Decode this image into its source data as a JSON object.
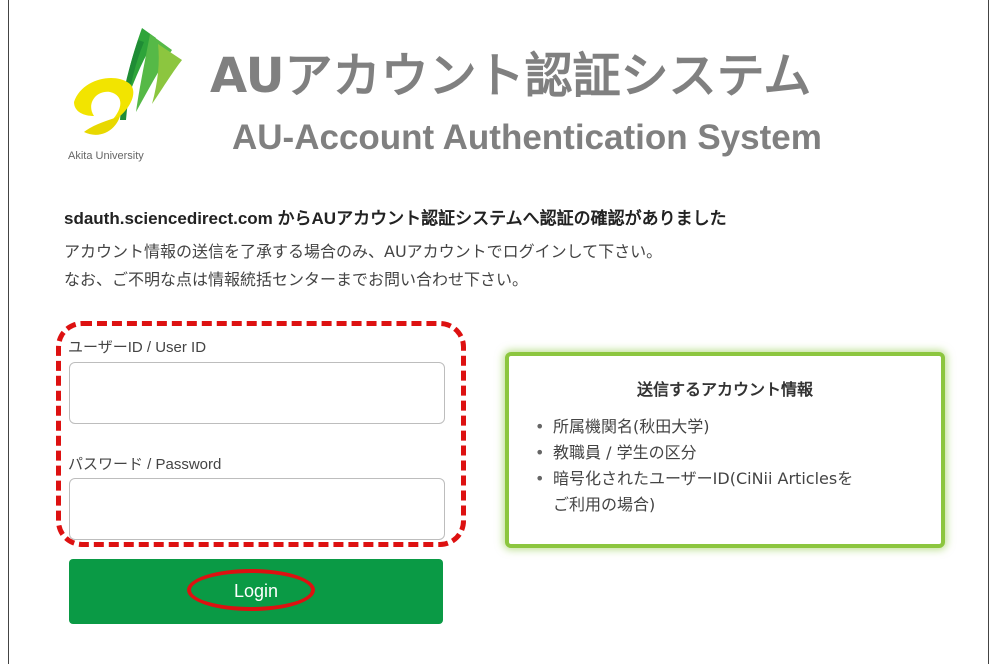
{
  "logo": {
    "caption": "Akita University"
  },
  "header": {
    "title_ja": "AUアカウント認証システム",
    "title_en": "AU-Account Authentication System"
  },
  "notice": "sdauth.sciencedirect.com からAUアカウント認証システムへ認証の確認がありました",
  "description": {
    "line1": "アカウント情報の送信を了承する場合のみ、AUアカウントでログインして下さい。",
    "line2": "なお、ご不明な点は情報統括センターまでお問い合わせ下さい。"
  },
  "form": {
    "userid_label": "ユーザーID / User ID",
    "userid_value": "",
    "password_label": "パスワード / Password",
    "password_value": "",
    "login_label": "Login"
  },
  "info": {
    "title": "送信するアカウント情報",
    "items": [
      "所属機関名(秋田大学)",
      "教職員 / 学生の区分",
      "暗号化されたユーザーID(CiNii Articlesを",
      "ご利用の場合)"
    ]
  },
  "colors": {
    "login_button": "#0a9a45",
    "info_border": "#8cc63f",
    "annotation": "#dd1111",
    "title_gray": "#808080"
  }
}
